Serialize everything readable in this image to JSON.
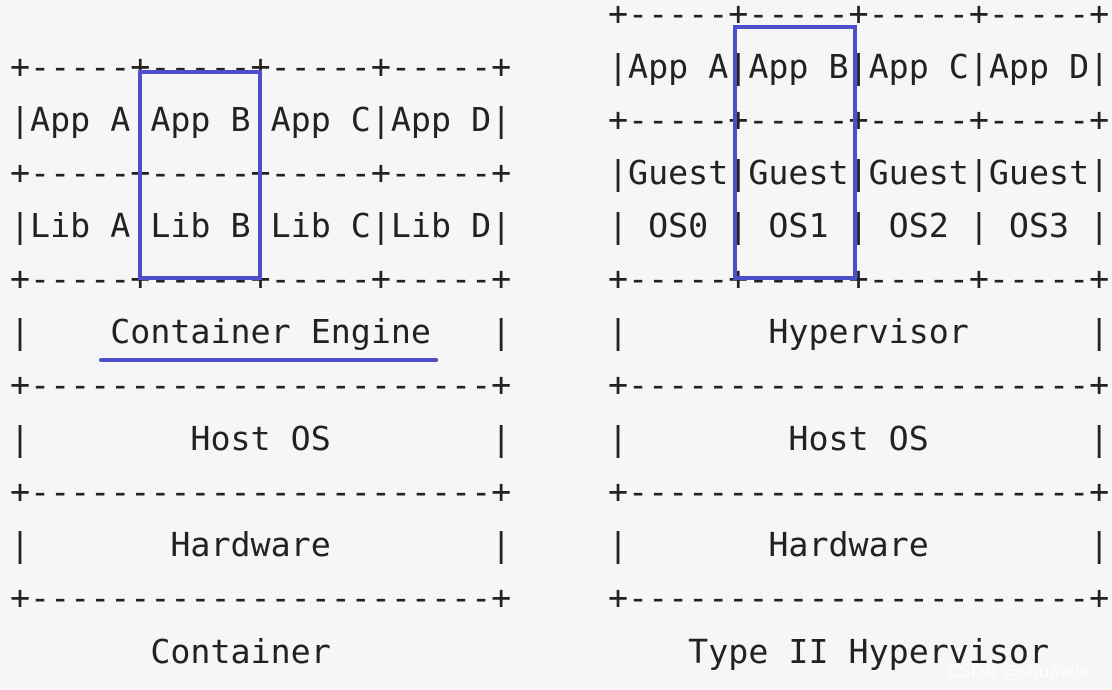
{
  "container": {
    "lines": [
      "+-----+-----+-----+-----+",
      "|App A|App B|App C|App D|",
      "+-----+-----+-----+-----+",
      "|Lib A|Lib B|Lib C|Lib D|",
      "+-----+-----+-----+-----+",
      "|    Container Engine   |",
      "+-----------------------+",
      "|        Host OS        |",
      "+-----------------------+",
      "|       Hardware        |",
      "+-----------------------+"
    ],
    "caption": "       Container         "
  },
  "hypervisor": {
    "lines": [
      "+-----+-----+-----+-----+",
      "|App A|App B|App C|App D|",
      "+-----+-----+-----+-----+",
      "|Guest|Guest|Guest|Guest|",
      "| OS0 | OS1 | OS2 | OS3 |",
      "+-----+-----+-----+-----+",
      "|       Hypervisor      |",
      "+-----------------------+",
      "|        Host OS        |",
      "+-----------------------+",
      "|       Hardware        |",
      "+-----------------------+"
    ],
    "caption": "    Type II Hypervisor   "
  },
  "highlight_color": "#4b4fc9",
  "watermark": "CSDN @shuaixio"
}
